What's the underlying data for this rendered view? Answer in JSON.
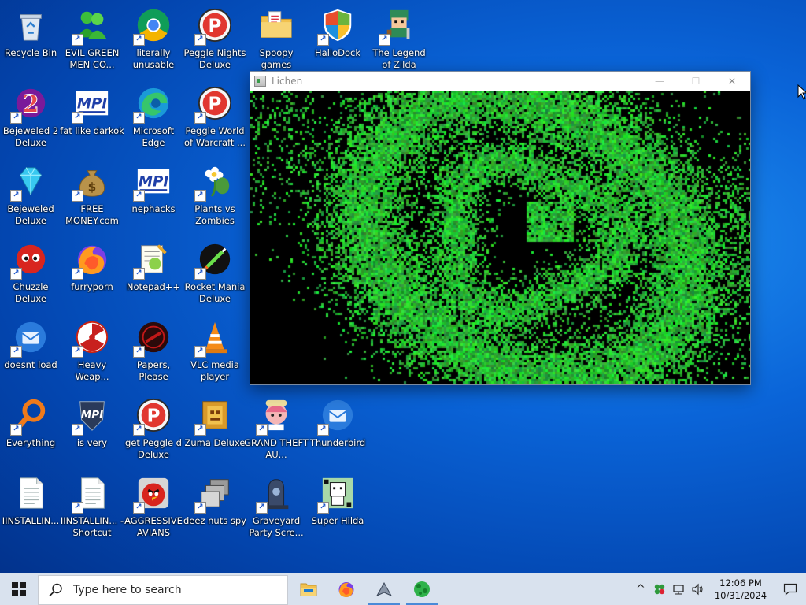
{
  "desktop_icons": [
    {
      "id": "recycle-bin",
      "label": "Recycle Bin",
      "icon": "recycle-bin-icon",
      "shortcut": false
    },
    {
      "id": "evil-green-men",
      "label": "EVIL GREEN MEN CO...",
      "icon": "green-people-icon",
      "shortcut": true
    },
    {
      "id": "literally-unusable",
      "label": "literally unusable",
      "icon": "chrome-icon",
      "shortcut": true
    },
    {
      "id": "peggle-nights",
      "label": "Peggle Nights Deluxe",
      "icon": "peggle-icon",
      "shortcut": true
    },
    {
      "id": "spoopy-games",
      "label": "Spoopy games",
      "icon": "folder-icon",
      "shortcut": false
    },
    {
      "id": "hallodock",
      "label": "HalloDock",
      "icon": "shield-icon",
      "shortcut": true
    },
    {
      "id": "legend-of-zilda",
      "label": "The Legend of Zilda",
      "icon": "hero-sprite-icon",
      "shortcut": true
    },
    {
      "id": "bejeweled2",
      "label": "Bejeweled 2 Deluxe",
      "icon": "bejeweled2-icon",
      "shortcut": true
    },
    {
      "id": "fat-like-darkok",
      "label": "fat like darkok",
      "icon": "mpi-icon",
      "shortcut": true
    },
    {
      "id": "microsoft-edge",
      "label": "Microsoft Edge",
      "icon": "edge-icon",
      "shortcut": true
    },
    {
      "id": "peggle-world",
      "label": "Peggle World of Warcraft ...",
      "icon": "peggle-icon",
      "shortcut": true
    },
    {
      "id": "bejeweled",
      "label": "Bejeweled Deluxe",
      "icon": "diamond-icon",
      "shortcut": true
    },
    {
      "id": "free-money",
      "label": "FREE MONEY.com",
      "icon": "money-bag-icon",
      "shortcut": true
    },
    {
      "id": "nephacks",
      "label": "nephacks",
      "icon": "mpi-icon",
      "shortcut": true
    },
    {
      "id": "plants-vs-zombies",
      "label": "Plants vs Zombies",
      "icon": "flower-icon",
      "shortcut": true
    },
    {
      "id": "chuzzle",
      "label": "Chuzzle Deluxe",
      "icon": "chuzzle-icon",
      "shortcut": true
    },
    {
      "id": "furryporn",
      "label": "furryporn",
      "icon": "firefox-icon",
      "shortcut": true
    },
    {
      "id": "notepadpp",
      "label": "Notepad++",
      "icon": "notepad-icon",
      "shortcut": true
    },
    {
      "id": "rocket-mania",
      "label": "Rocket Mania Deluxe",
      "icon": "rocket-icon",
      "shortcut": true
    },
    {
      "id": "doesnt-load",
      "label": "doesnt load",
      "icon": "thunderbird-icon",
      "shortcut": true
    },
    {
      "id": "heavy-weapon",
      "label": "Heavy Weap...",
      "icon": "radiation-icon",
      "shortcut": true
    },
    {
      "id": "papers-please",
      "label": "Papers, Please",
      "icon": "seal-icon",
      "shortcut": true
    },
    {
      "id": "vlc",
      "label": "VLC media player",
      "icon": "vlc-cone-icon",
      "shortcut": true
    },
    {
      "id": "everything",
      "label": "Everything",
      "icon": "magnifier-icon",
      "shortcut": true
    },
    {
      "id": "is-very",
      "label": "is very",
      "icon": "mpi-shield-icon",
      "shortcut": true
    },
    {
      "id": "get-peggle",
      "label": "get Peggle d Deluxe",
      "icon": "peggle-icon",
      "shortcut": true
    },
    {
      "id": "zuma",
      "label": "Zuma Deluxe",
      "icon": "zuma-icon",
      "shortcut": true
    },
    {
      "id": "grand-theft",
      "label": "GRAND THEFT AU...",
      "icon": "anime-girl-icon",
      "shortcut": true
    },
    {
      "id": "thunderbird",
      "label": "Thunderbird",
      "icon": "thunderbird-icon",
      "shortcut": true
    },
    {
      "id": "installing1",
      "label": "IINSTALLIN...",
      "icon": "text-file-icon",
      "shortcut": false
    },
    {
      "id": "installing2",
      "label": "IINSTALLIN... - Shortcut",
      "icon": "text-file-icon",
      "shortcut": true
    },
    {
      "id": "aggressive-avians",
      "label": "AGGRESSIVE AVIANS",
      "icon": "angry-bird-icon",
      "shortcut": true
    },
    {
      "id": "deez-nuts-spy",
      "label": "deez nuts spy",
      "icon": "windows-stack-icon",
      "shortcut": true
    },
    {
      "id": "graveyard",
      "label": "Graveyard Party Scre...",
      "icon": "tombstone-icon",
      "shortcut": true
    },
    {
      "id": "super-hilda",
      "label": "Super Hilda",
      "icon": "pixel-character-icon",
      "shortcut": true
    }
  ],
  "window": {
    "title": "Lichen",
    "minimize_glyph": "—",
    "maximize_glyph": "☐",
    "close_glyph": "✕"
  },
  "taskbar": {
    "search_placeholder": "Type here to search",
    "apps": [
      {
        "id": "file-explorer",
        "icon": "folder-icon",
        "active": false
      },
      {
        "id": "firefox",
        "icon": "firefox-icon",
        "active": false
      },
      {
        "id": "pinned-app",
        "icon": "spaceship-icon",
        "active": true
      },
      {
        "id": "lichen",
        "icon": "lichen-icon",
        "active": true
      }
    ],
    "tray": {
      "overflow_glyph": "^",
      "time": "12:06 PM",
      "date": "10/31/2024"
    }
  },
  "colors": {
    "desktop_bg": "#0a64d8",
    "taskbar_bg": "#d9e2ee",
    "lichen_green": "#35c04a"
  }
}
